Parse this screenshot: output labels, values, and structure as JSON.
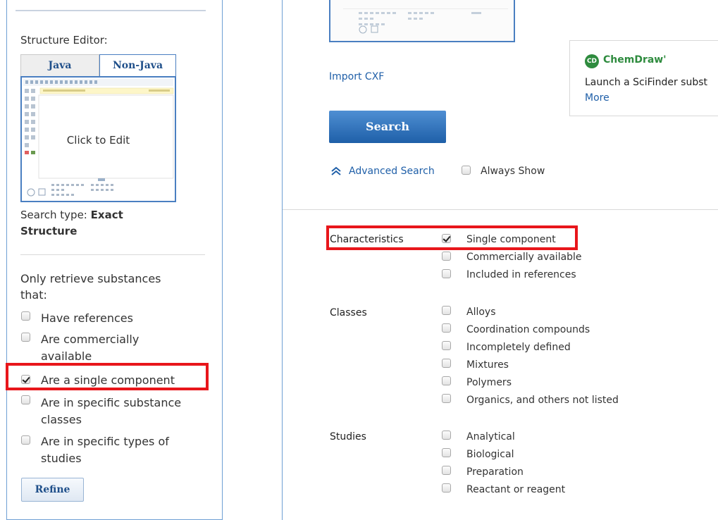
{
  "left": {
    "structure_editor_label": "Structure Editor:",
    "tabs": [
      {
        "label": "Java",
        "active": false
      },
      {
        "label": "Non-Java",
        "active": true
      }
    ],
    "editor_placeholder": "Click to Edit",
    "search_type_label": "Search type:",
    "search_type_value_line1": "Exact",
    "search_type_value_line2": "Structure",
    "retrieve_label_line1": "Only retrieve substances",
    "retrieve_label_line2": "that:",
    "options": [
      {
        "lines": [
          "Have references"
        ],
        "checked": false
      },
      {
        "lines": [
          "Are commercially",
          "available"
        ],
        "checked": false
      },
      {
        "lines": [
          "Are a single component"
        ],
        "checked": true
      },
      {
        "lines": [
          "Are in specific substance",
          "classes"
        ],
        "checked": false
      },
      {
        "lines": [
          "Are in specific types of",
          "studies"
        ],
        "checked": false
      }
    ],
    "refine_label": "Refine"
  },
  "right": {
    "import_link": "Import CXF",
    "search_label": "Search",
    "advanced_search_label": "Advanced Search",
    "always_show_label": "Always Show",
    "chemdraw": {
      "logo_text": "CD",
      "name": "ChemDraw'",
      "description": "Launch a SciFinder subst",
      "more": "More"
    },
    "filters": [
      {
        "category": "Characteristics",
        "options": [
          {
            "label": "Single component",
            "checked": true
          },
          {
            "label": "Commercially available",
            "checked": false
          },
          {
            "label": "Included in references",
            "checked": false
          }
        ]
      },
      {
        "category": "Classes",
        "options": [
          {
            "label": "Alloys",
            "checked": false
          },
          {
            "label": "Coordination compounds",
            "checked": false
          },
          {
            "label": "Incompletely defined",
            "checked": false
          },
          {
            "label": "Mixtures",
            "checked": false
          },
          {
            "label": "Polymers",
            "checked": false
          },
          {
            "label": "Organics, and others not listed",
            "checked": false
          }
        ]
      },
      {
        "category": "Studies",
        "options": [
          {
            "label": "Analytical",
            "checked": false
          },
          {
            "label": "Biological",
            "checked": false
          },
          {
            "label": "Preparation",
            "checked": false
          },
          {
            "label": "Reactant or reagent",
            "checked": false
          }
        ]
      }
    ]
  },
  "colors": {
    "panel_border": "#6e9fd4",
    "link": "#1f5fa8",
    "highlight": "#e8161b",
    "search_button": "#2f6fba",
    "chemdraw_green": "#2e8b3e"
  }
}
